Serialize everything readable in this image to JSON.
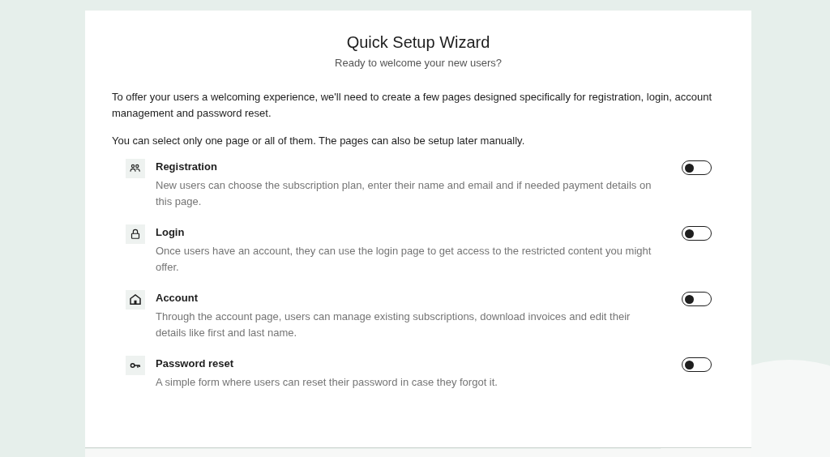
{
  "title": "Quick Setup Wizard",
  "subtitle": "Ready to welcome your new users?",
  "paragraphs": [
    "To offer your users a welcoming experience, we'll need to create a few pages designed specifically for registration, login, account management and password reset.",
    "You can select only one page or all of them. The pages can also be setup later manually."
  ],
  "pages": [
    {
      "kind": "people",
      "title": "Registration",
      "description": "New users can choose the subscription plan, enter their name and email and if needed payment details on this page.",
      "on": false
    },
    {
      "kind": "lock",
      "title": "Login",
      "description": "Once users have an account, they can use the login page to get access to the restricted content you might offer.",
      "on": false
    },
    {
      "kind": "home",
      "title": "Account",
      "description": "Through the account page, users can manage existing subscriptions, download invoices and edit their details like first and last name.",
      "on": false
    },
    {
      "kind": "key",
      "title": "Password reset",
      "description": "A simple form where users can reset their password in case they forgot it.",
      "on": false
    }
  ]
}
